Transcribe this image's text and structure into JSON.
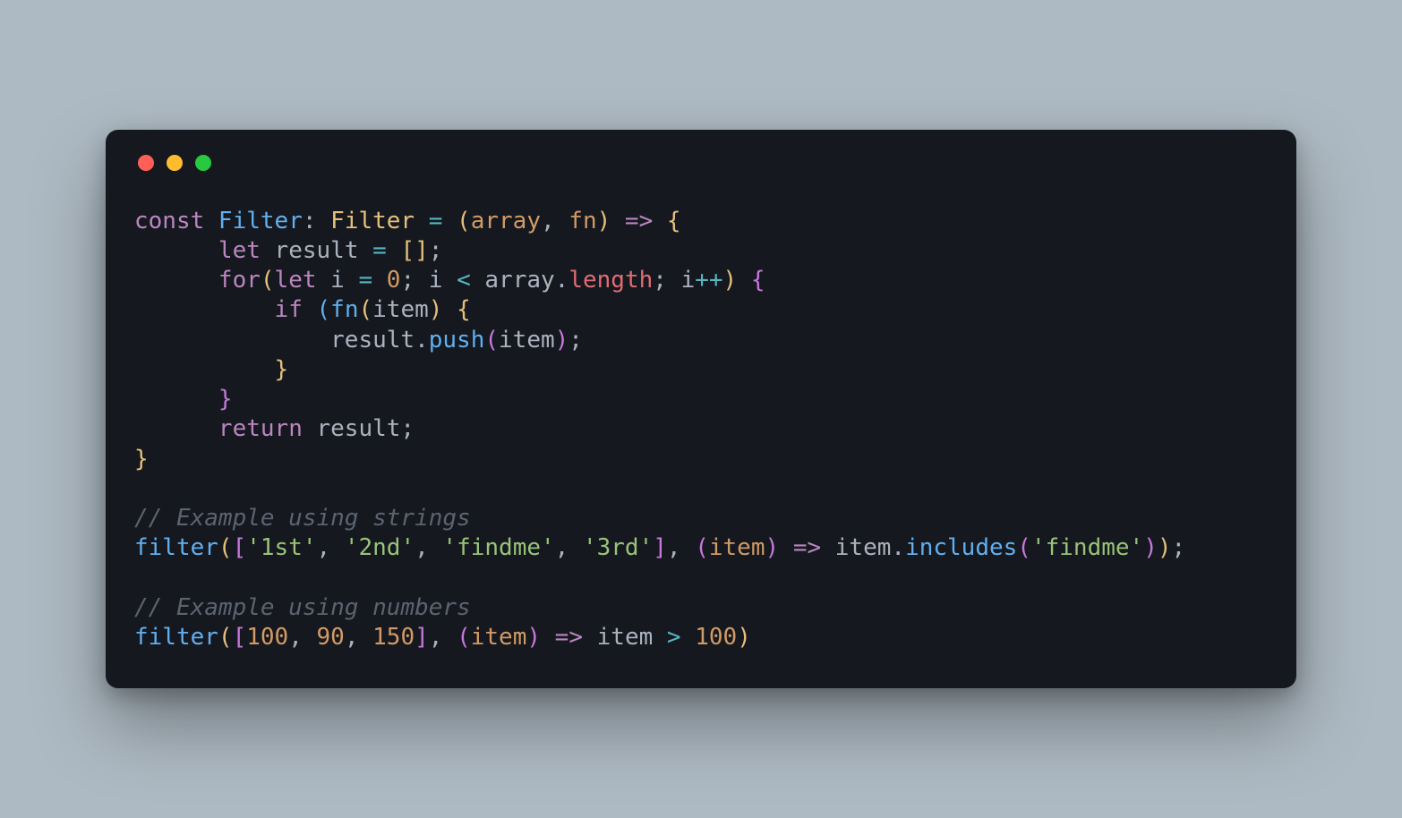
{
  "tokens": [
    [
      {
        "t": "const ",
        "c": "tok-kw"
      },
      {
        "t": "Filter",
        "c": "tok-decl"
      },
      {
        "t": ": ",
        "c": "tok-white"
      },
      {
        "t": "Filter",
        "c": "tok-type"
      },
      {
        "t": " ",
        "c": "tok-white"
      },
      {
        "t": "=",
        "c": "tok-op"
      },
      {
        "t": " ",
        "c": "tok-white"
      },
      {
        "t": "(",
        "c": "tok-yellow"
      },
      {
        "t": "array",
        "c": "tok-param"
      },
      {
        "t": ", ",
        "c": "tok-white"
      },
      {
        "t": "fn",
        "c": "tok-param"
      },
      {
        "t": ")",
        "c": "tok-yellow"
      },
      {
        "t": " ",
        "c": "tok-white"
      },
      {
        "t": "=>",
        "c": "tok-arrow"
      },
      {
        "t": " ",
        "c": "tok-white"
      },
      {
        "t": "{",
        "c": "tok-yellow"
      }
    ],
    [
      {
        "t": "      ",
        "c": "tok-white"
      },
      {
        "t": "let ",
        "c": "tok-kw"
      },
      {
        "t": "result",
        "c": "tok-ident"
      },
      {
        "t": " ",
        "c": "tok-white"
      },
      {
        "t": "=",
        "c": "tok-op"
      },
      {
        "t": " ",
        "c": "tok-white"
      },
      {
        "t": "[]",
        "c": "tok-yellow"
      },
      {
        "t": ";",
        "c": "tok-white"
      }
    ],
    [
      {
        "t": "      ",
        "c": "tok-white"
      },
      {
        "t": "for",
        "c": "tok-kw"
      },
      {
        "t": "(",
        "c": "tok-yellow"
      },
      {
        "t": "let ",
        "c": "tok-kw"
      },
      {
        "t": "i",
        "c": "tok-ident"
      },
      {
        "t": " ",
        "c": "tok-white"
      },
      {
        "t": "=",
        "c": "tok-op"
      },
      {
        "t": " ",
        "c": "tok-white"
      },
      {
        "t": "0",
        "c": "tok-num"
      },
      {
        "t": "; ",
        "c": "tok-white"
      },
      {
        "t": "i",
        "c": "tok-ident"
      },
      {
        "t": " ",
        "c": "tok-white"
      },
      {
        "t": "<",
        "c": "tok-op"
      },
      {
        "t": " ",
        "c": "tok-white"
      },
      {
        "t": "array",
        "c": "tok-ident"
      },
      {
        "t": ".",
        "c": "tok-white"
      },
      {
        "t": "length",
        "c": "tok-red"
      },
      {
        "t": "; ",
        "c": "tok-white"
      },
      {
        "t": "i",
        "c": "tok-ident"
      },
      {
        "t": "++",
        "c": "tok-op"
      },
      {
        "t": ")",
        "c": "tok-yellow"
      },
      {
        "t": " ",
        "c": "tok-white"
      },
      {
        "t": "{",
        "c": "tok-magenta"
      }
    ],
    [
      {
        "t": "          ",
        "c": "tok-white"
      },
      {
        "t": "if ",
        "c": "tok-kw"
      },
      {
        "t": "(",
        "c": "tok-blue"
      },
      {
        "t": "fn",
        "c": "tok-call"
      },
      {
        "t": "(",
        "c": "tok-yellow"
      },
      {
        "t": "item",
        "c": "tok-ident"
      },
      {
        "t": ")",
        "c": "tok-yellow"
      },
      {
        "t": " ",
        "c": "tok-white"
      },
      {
        "t": "{",
        "c": "tok-yellow"
      }
    ],
    [
      {
        "t": "              ",
        "c": "tok-white"
      },
      {
        "t": "result",
        "c": "tok-ident"
      },
      {
        "t": ".",
        "c": "tok-white"
      },
      {
        "t": "push",
        "c": "tok-call"
      },
      {
        "t": "(",
        "c": "tok-magenta"
      },
      {
        "t": "item",
        "c": "tok-ident"
      },
      {
        "t": ")",
        "c": "tok-magenta"
      },
      {
        "t": ";",
        "c": "tok-white"
      }
    ],
    [
      {
        "t": "          ",
        "c": "tok-white"
      },
      {
        "t": "}",
        "c": "tok-yellow"
      }
    ],
    [
      {
        "t": "      ",
        "c": "tok-white"
      },
      {
        "t": "}",
        "c": "tok-magenta"
      }
    ],
    [
      {
        "t": "      ",
        "c": "tok-white"
      },
      {
        "t": "return ",
        "c": "tok-kw"
      },
      {
        "t": "result",
        "c": "tok-ident"
      },
      {
        "t": ";",
        "c": "tok-white"
      }
    ],
    [
      {
        "t": "}",
        "c": "tok-yellow"
      }
    ],
    [
      {
        "t": "",
        "c": "tok-white"
      }
    ],
    [
      {
        "t": "// Example using strings",
        "c": "tok-comment"
      }
    ],
    [
      {
        "t": "filter",
        "c": "tok-call"
      },
      {
        "t": "(",
        "c": "tok-yellow"
      },
      {
        "t": "[",
        "c": "tok-magenta"
      },
      {
        "t": "'1st'",
        "c": "tok-str"
      },
      {
        "t": ", ",
        "c": "tok-white"
      },
      {
        "t": "'2nd'",
        "c": "tok-str"
      },
      {
        "t": ", ",
        "c": "tok-white"
      },
      {
        "t": "'findme'",
        "c": "tok-str"
      },
      {
        "t": ", ",
        "c": "tok-white"
      },
      {
        "t": "'3rd'",
        "c": "tok-str"
      },
      {
        "t": "]",
        "c": "tok-magenta"
      },
      {
        "t": ", ",
        "c": "tok-white"
      },
      {
        "t": "(",
        "c": "tok-magenta"
      },
      {
        "t": "item",
        "c": "tok-param"
      },
      {
        "t": ")",
        "c": "tok-magenta"
      },
      {
        "t": " ",
        "c": "tok-white"
      },
      {
        "t": "=>",
        "c": "tok-arrow"
      },
      {
        "t": " ",
        "c": "tok-white"
      },
      {
        "t": "item",
        "c": "tok-ident"
      },
      {
        "t": ".",
        "c": "tok-white"
      },
      {
        "t": "includes",
        "c": "tok-call"
      },
      {
        "t": "(",
        "c": "tok-magenta"
      },
      {
        "t": "'findme'",
        "c": "tok-str"
      },
      {
        "t": ")",
        "c": "tok-magenta"
      },
      {
        "t": ")",
        "c": "tok-yellow"
      },
      {
        "t": ";",
        "c": "tok-white"
      }
    ],
    [
      {
        "t": "",
        "c": "tok-white"
      }
    ],
    [
      {
        "t": "// Example using numbers",
        "c": "tok-comment"
      }
    ],
    [
      {
        "t": "filter",
        "c": "tok-call"
      },
      {
        "t": "(",
        "c": "tok-yellow"
      },
      {
        "t": "[",
        "c": "tok-magenta"
      },
      {
        "t": "100",
        "c": "tok-num"
      },
      {
        "t": ", ",
        "c": "tok-white"
      },
      {
        "t": "90",
        "c": "tok-num"
      },
      {
        "t": ", ",
        "c": "tok-white"
      },
      {
        "t": "150",
        "c": "tok-num"
      },
      {
        "t": "]",
        "c": "tok-magenta"
      },
      {
        "t": ", ",
        "c": "tok-white"
      },
      {
        "t": "(",
        "c": "tok-magenta"
      },
      {
        "t": "item",
        "c": "tok-param"
      },
      {
        "t": ")",
        "c": "tok-magenta"
      },
      {
        "t": " ",
        "c": "tok-white"
      },
      {
        "t": "=>",
        "c": "tok-arrow"
      },
      {
        "t": " ",
        "c": "tok-white"
      },
      {
        "t": "item",
        "c": "tok-ident"
      },
      {
        "t": " ",
        "c": "tok-white"
      },
      {
        "t": ">",
        "c": "tok-op"
      },
      {
        "t": " ",
        "c": "tok-white"
      },
      {
        "t": "100",
        "c": "tok-num"
      },
      {
        "t": ")",
        "c": "tok-yellow"
      }
    ]
  ]
}
